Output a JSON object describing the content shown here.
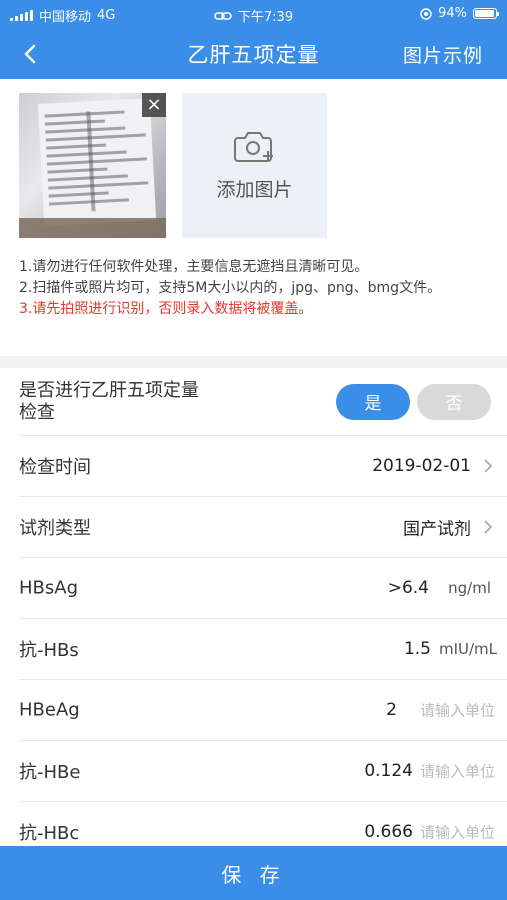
{
  "status_bar": {
    "carrier": "中国移动",
    "network": "4G",
    "time": "下午7:39",
    "battery": "94%",
    "battery_level": 0.94
  },
  "nav": {
    "title": "乙肝五项定量",
    "right_label": "图片示例"
  },
  "upload": {
    "close_label": "×",
    "add_label": "添加图片"
  },
  "notes": [
    "1.请勿进行任何软件处理，主要信息无遮挡且清晰可见。",
    "2.扫描件或照片均可，支持5M大小以内的，jpg、png、bmg文件。",
    "3.请先拍照进行识别，否则录入数据将被覆盖。"
  ],
  "form": {
    "question": {
      "label_line1": "是否进行乙肝五项定量",
      "label_line2": "检查",
      "yes": "是",
      "no": "否",
      "selected": "是"
    },
    "exam_time": {
      "label": "检查时间",
      "value": "2019-02-01"
    },
    "reagent": {
      "label": "试剂类型",
      "value": "国产试剂"
    },
    "items": [
      {
        "label": "HBsAg",
        "value": ">6.4",
        "unit": "ng/ml",
        "unit_is_placeholder": false
      },
      {
        "label": "抗-HBs",
        "value": "1.5",
        "unit": "mIU/mL",
        "unit_is_placeholder": false
      },
      {
        "label": "HBeAg",
        "value": "2",
        "unit": "请输入单位",
        "unit_is_placeholder": true
      },
      {
        "label": "抗-HBe",
        "value": "0.124",
        "unit": "请输入单位",
        "unit_is_placeholder": true
      },
      {
        "label": "抗-HBc",
        "value": "0.666",
        "unit": "请输入单位",
        "unit_is_placeholder": true
      }
    ]
  },
  "save_label": "保 存",
  "colors": {
    "primary": "#3b8ee8",
    "warning": "#e23a2c",
    "toggle_off": "#d9d9d9"
  },
  "icons": [
    "back-arrow-icon",
    "camera-plus-icon",
    "chevron-right-icon",
    "close-icon",
    "signal-icon",
    "wifi-icon",
    "battery-icon",
    "location-icon"
  ]
}
